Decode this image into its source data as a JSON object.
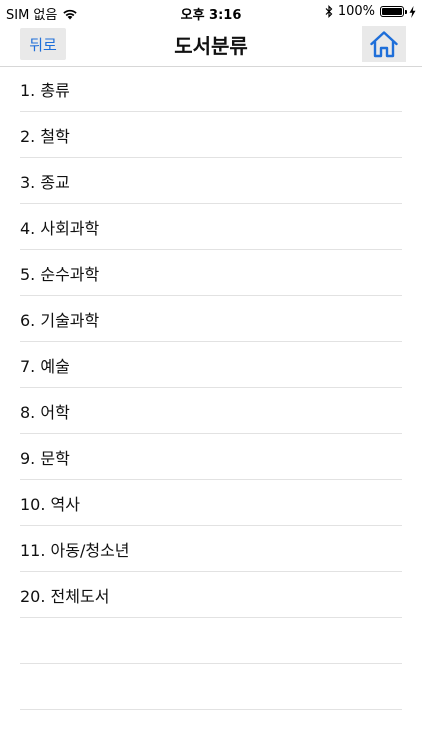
{
  "status_bar": {
    "carrier": "SIM 없음",
    "time": "오후 3:16",
    "battery": "100%",
    "battery_level": 1.0
  },
  "nav": {
    "back_label": "뒤로",
    "title": "도서분류"
  },
  "categories": [
    {
      "label": "1. 총류"
    },
    {
      "label": "2. 철학"
    },
    {
      "label": "3. 종교"
    },
    {
      "label": "4. 사회과학"
    },
    {
      "label": "5. 순수과학"
    },
    {
      "label": "6. 기술과학"
    },
    {
      "label": "7. 예술"
    },
    {
      "label": "8. 어학"
    },
    {
      "label": "9. 문학"
    },
    {
      "label": "10. 역사"
    },
    {
      "label": "11. 아동/청소년"
    },
    {
      "label": "20. 전체도서"
    }
  ],
  "icons": {
    "wifi": "wifi-icon",
    "bluetooth": "bluetooth-icon",
    "battery": "battery-icon",
    "charging": "charging-icon",
    "home": "home-icon"
  },
  "colors": {
    "accent": "#1f6fd9",
    "button_bg": "#e9e9e9"
  }
}
